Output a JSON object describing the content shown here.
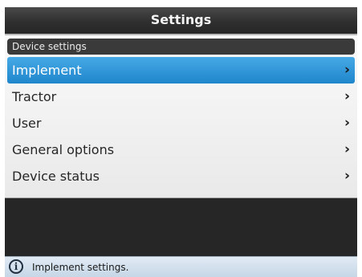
{
  "window": {
    "title": "Settings"
  },
  "section": {
    "header": "Device settings"
  },
  "menu": {
    "items": [
      {
        "label": "Implement",
        "selected": true
      },
      {
        "label": "Tractor",
        "selected": false
      },
      {
        "label": "User",
        "selected": false
      },
      {
        "label": "General options",
        "selected": false
      },
      {
        "label": "Device status",
        "selected": false
      }
    ],
    "chevron": "›"
  },
  "status": {
    "icon": "info-icon",
    "icon_glyph": "i",
    "text": "Implement settings."
  },
  "colors": {
    "selected_bg": "#2c93d8",
    "title_bg": "#2f2f2f",
    "status_bg": "#d3e1ee"
  }
}
